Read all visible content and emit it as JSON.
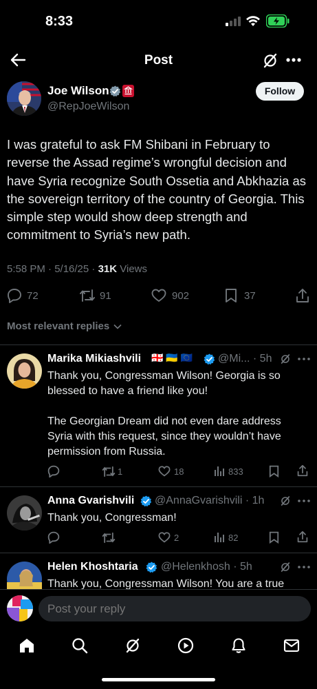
{
  "status_bar": {
    "time": "8:33"
  },
  "header": {
    "title": "Post"
  },
  "tweet": {
    "author_name": "Joe Wilson",
    "author_handle": "@RepJoeWilson",
    "follow_label": "Follow",
    "body": "I was grateful to ask FM Shibani in February to reverse the Assad regime’s wrongful decision and have Syria recognize South Ossetia and Abkhazia as the sovereign territory of the country of Georgia. This simple step would show deep strength and commitment to Syria’s new path.",
    "meta_time": "5:58 PM · 5/16/25 · ",
    "views_count": "31K",
    "views_label": " Views",
    "stats": {
      "replies": "72",
      "reposts": "91",
      "likes": "902",
      "bookmarks": "37"
    }
  },
  "replies_sort": "Most relevant replies",
  "replies": [
    {
      "name": "Marika Mikiashvili",
      "flags": "🇬🇪 🇺🇦 🇪🇺",
      "handle": "@Mi... · 5h",
      "text1": "Thank you, Congressman Wilson! Georgia is so blessed to have a friend like you!",
      "text2": "The Georgian Dream did not even dare address Syria with this request, since they wouldn’t have permission from Russia.",
      "reposts": "1",
      "likes": "18",
      "views": "833"
    },
    {
      "name": "Anna Gvarishvili",
      "handle": "@AnnaGvarishvili · 1h",
      "text1": "Thank you, Congressman!",
      "reposts": "",
      "likes": "2",
      "views": "82"
    },
    {
      "name": "Helen Khoshtaria",
      "handle": "@Helenkhosh · 5h",
      "text1": "Thank you, Congressman Wilson! You are a true"
    }
  ],
  "composer": {
    "placeholder": "Post your reply"
  },
  "colors": {
    "background": "#000000",
    "verified": "#1d9bf0",
    "muted": "#71767b",
    "battery": "#30d158"
  }
}
